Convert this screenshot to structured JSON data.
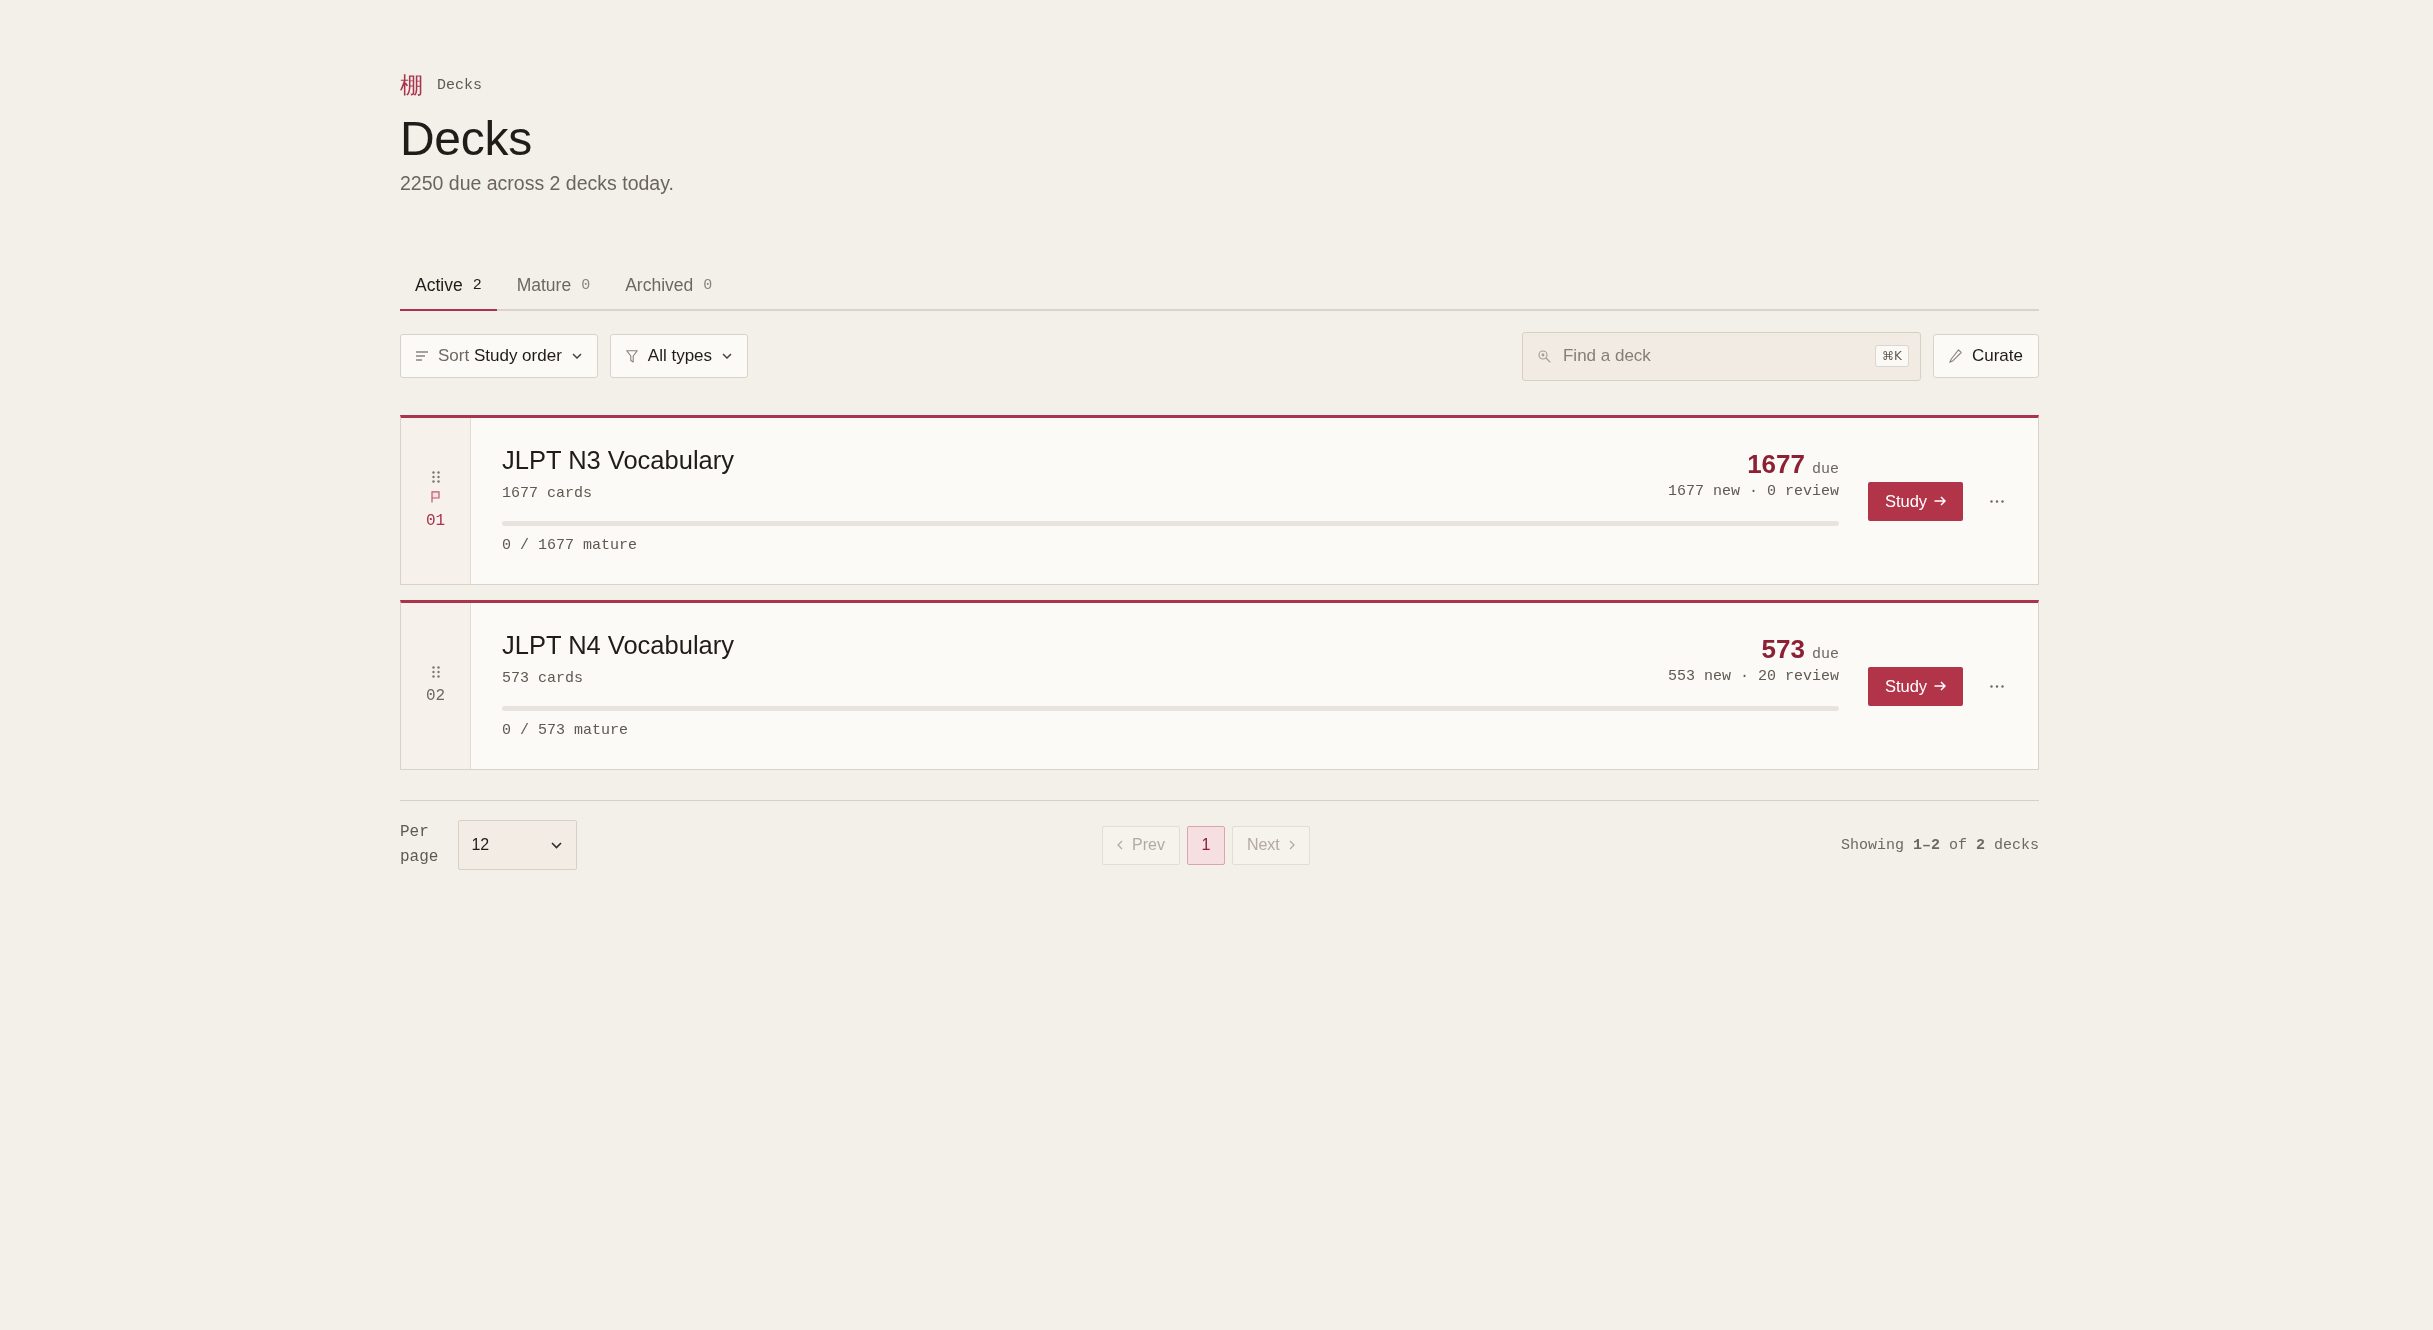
{
  "breadcrumb": {
    "logo": "棚",
    "current": "Decks"
  },
  "header": {
    "title": "Decks",
    "subtitle": "2250 due across 2 decks today."
  },
  "tabs": [
    {
      "label": "Active",
      "count": "2",
      "selected": true
    },
    {
      "label": "Mature",
      "count": "0",
      "selected": false
    },
    {
      "label": "Archived",
      "count": "0",
      "selected": false
    }
  ],
  "toolbar": {
    "sort": {
      "label": "Sort",
      "value": "Study order"
    },
    "type_filter": {
      "value": "All types"
    },
    "search": {
      "placeholder": "Find a deck",
      "shortcut": "⌘K"
    },
    "curate_button": "Curate"
  },
  "decks": [
    {
      "index": "01",
      "pinned": true,
      "title": "JLPT N3 Vocabulary",
      "cards": "1677 cards",
      "due_count": "1677",
      "due_label": "due",
      "breakdown": "1677 new · 0 review",
      "level": 0,
      "mature": "0 / 1677 mature",
      "study_label": "Study"
    },
    {
      "index": "02",
      "pinned": false,
      "title": "JLPT N4 Vocabulary",
      "cards": "573 cards",
      "due_count": "573",
      "due_label": "due",
      "breakdown": "553 new · 20 review",
      "level": 0,
      "mature": "0 / 573 mature",
      "study_label": "Study"
    }
  ],
  "pagination": {
    "per_page_label": "Per page",
    "per_page_value": "12",
    "prev": {
      "label": "Prev",
      "disabled": true
    },
    "pages": [
      {
        "label": "1",
        "selected": true
      }
    ],
    "next": {
      "label": "Next",
      "disabled": true
    },
    "summary": "Showing **1–2** of **2** decks"
  }
}
